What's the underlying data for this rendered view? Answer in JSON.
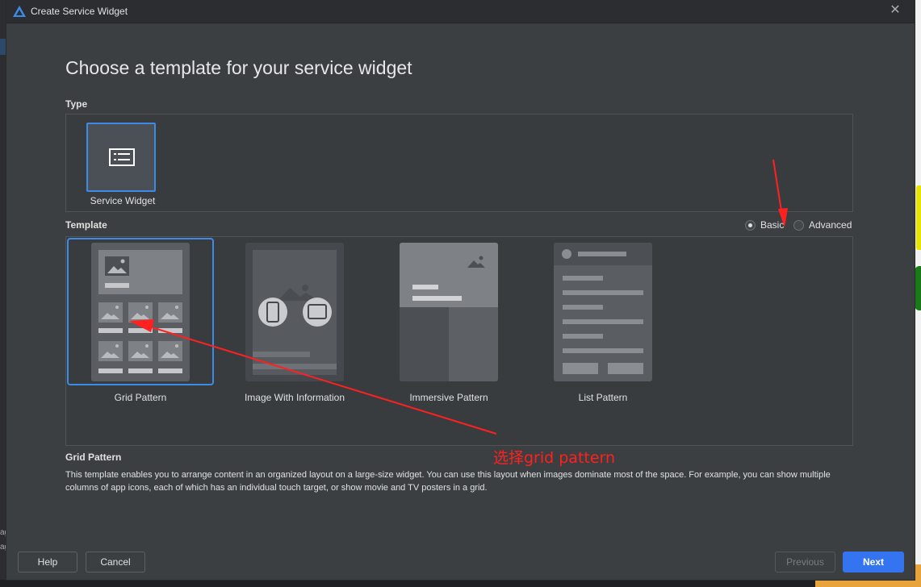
{
  "window": {
    "title": "Create Service Widget"
  },
  "heading": "Choose a template for your service widget",
  "type_section": {
    "label": "Type",
    "items": [
      {
        "label": "Service Widget",
        "selected": true
      }
    ]
  },
  "template_section": {
    "label": "Template",
    "mode_options": [
      {
        "label": "Basic",
        "selected": true
      },
      {
        "label": "Advanced",
        "selected": false
      }
    ],
    "items": [
      {
        "label": "Grid Pattern",
        "selected": true
      },
      {
        "label": "Image With Information",
        "selected": false
      },
      {
        "label": "Immersive Pattern",
        "selected": false
      },
      {
        "label": "List Pattern",
        "selected": false
      }
    ]
  },
  "description": {
    "title": "Grid Pattern",
    "text": "This template enables you to arrange content in an organized layout on a large-size widget. You can use this layout when images dominate most of the space. For example, you can show multiple columns of app icons, each of which has an individual touch target, or show movie and TV posters in a grid."
  },
  "annotation": {
    "text": "选择grid pattern",
    "color": "#ff2020"
  },
  "buttons": {
    "help": "Help",
    "cancel": "Cancel",
    "previous": "Previous",
    "next": "Next"
  },
  "background": {
    "left_edge_texts": [
      "ag",
      "ag"
    ]
  },
  "colors": {
    "accent": "#3574f0",
    "selection_border": "#3c8ce7",
    "dialog_bg": "#3c3f41",
    "annotation": "#ff2020"
  },
  "icons": [
    "app-logo-icon",
    "close-icon",
    "list-card-icon",
    "image-icon",
    "phone-icon",
    "tablet-icon"
  ]
}
